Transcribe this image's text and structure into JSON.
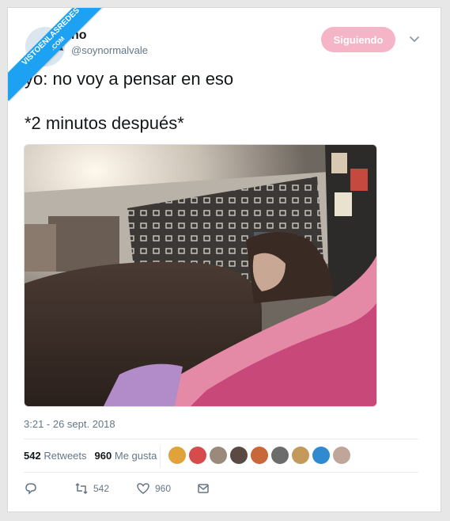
{
  "watermark": {
    "line1": "VISTOENLASREDES",
    "line2": ".COM"
  },
  "author": {
    "name": "no",
    "handle": "@soynormalvale"
  },
  "follow_button": {
    "label": "Siguiendo",
    "color": "#f6b5c6"
  },
  "tweet": {
    "line1": "yo: no voy a pensar en eso",
    "line2": "*2 minutos después*"
  },
  "timestamp": "3:21 - 26 sept. 2018",
  "stats": {
    "retweets_count": "542",
    "retweets_label": "Retweets",
    "likes_count": "960",
    "likes_label": "Me gusta"
  },
  "actions": {
    "retweets": "542",
    "likes": "960"
  },
  "colors": {
    "accent": "#1da1f2",
    "muted": "#657786",
    "text": "#14171a"
  },
  "icons": [
    "chevron-down-icon",
    "reply-icon",
    "retweet-icon",
    "heart-icon",
    "message-icon"
  ]
}
